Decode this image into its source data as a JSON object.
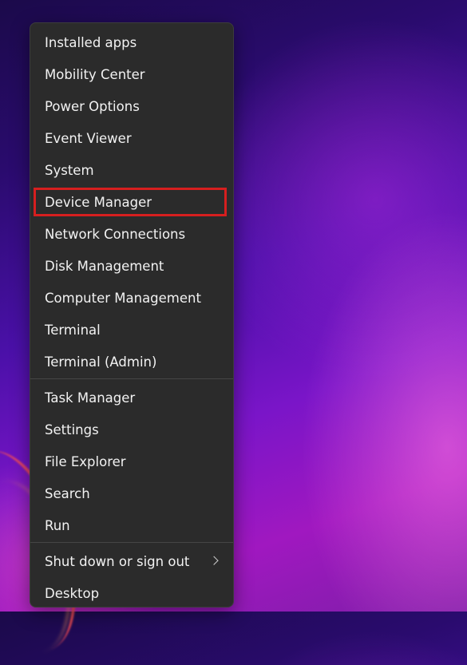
{
  "menu": {
    "groups": [
      {
        "items": [
          {
            "label": "Installed apps"
          },
          {
            "label": "Mobility Center"
          },
          {
            "label": "Power Options"
          },
          {
            "label": "Event Viewer"
          },
          {
            "label": "System"
          },
          {
            "label": "Device Manager",
            "highlighted": true
          },
          {
            "label": "Network Connections"
          },
          {
            "label": "Disk Management"
          },
          {
            "label": "Computer Management"
          },
          {
            "label": "Terminal"
          },
          {
            "label": "Terminal (Admin)"
          }
        ]
      },
      {
        "items": [
          {
            "label": "Task Manager"
          },
          {
            "label": "Settings"
          },
          {
            "label": "File Explorer"
          },
          {
            "label": "Search"
          },
          {
            "label": "Run"
          }
        ]
      },
      {
        "items": [
          {
            "label": "Shut down or sign out",
            "submenu_icon": "chevron-right-icon"
          },
          {
            "label": "Desktop"
          }
        ]
      }
    ]
  },
  "colors": {
    "menu_background": "#2b2b2b",
    "text": "#f2f2f2",
    "highlight_border": "#d61f1f"
  }
}
